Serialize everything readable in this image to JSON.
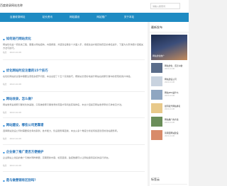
{
  "header": {
    "logo": "百度收录网站名称",
    "search_placeholder": "请输入搜索词"
  },
  "nav": [
    "百度收录网址",
    "站长资讯",
    "网站建设",
    "网站推广",
    "关于本站"
  ],
  "posts": [
    {
      "title": "如何进行网站优化",
      "body": "网站优化是一项系统工程，需要从网站结构、内容质量、外链建设等多个方面入手，持续改进才能获得稳定的排名提升，下面为大家详细介绍相关方法与技巧。",
      "meta": [
        "站长",
        "2022-10-08"
      ]
    },
    {
      "title": "优化网站时应注意的15个技巧",
      "body": "在优化网站的过程中需要注意很多细节问题，本文总结了十五个实用技巧，帮助站长更好地提升网站在搜索引擎中的表现和用户体验。",
      "meta": [
        "站长",
        "2022-10-08"
      ]
    },
    {
      "title": "网站收录，怎么做？",
      "body": "网站收录是搜索引擎优化的基础，只有被搜索引擎收录的页面才有机会获得排名，本文介绍提高网站收录率的几种常见方法。",
      "meta": [
        "站长",
        "2022-10-08"
      ]
    },
    {
      "title": "网站建设，哪些公司更靠谱",
      "body": "选择网站建设公司时需要综合考虑案例、技术能力、售后服务等因素，本文从多个角度分析如何挑选靠谱的建站服务商。",
      "meta": [
        "站长",
        "2022-10-08"
      ]
    },
    {
      "title": "企业做了推广是否方便维护",
      "body": "企业网站上线后的推广与维护同样重要，定期更新内容、检查链接、监控数据可以让网站保持良好的运行状态。",
      "meta": [
        "站长",
        "2022-10-08"
      ]
    },
    {
      "title": "是与做营销有区别吗？",
      "body": "",
      "meta": []
    }
  ],
  "side": {
    "title": "最新发布",
    "banner_caption": "网站优化推广",
    "items": [
      {
        "text": "网站优化，该怎么做",
        "date": "2022-10-08"
      },
      {
        "text": "网站建设公司",
        "date": "2022-10-08"
      },
      {
        "text": "网站SEO是什么",
        "date": "2022-10-08"
      },
      {
        "text": "如何提升网站排名",
        "date": "2022-10-08"
      },
      {
        "text": "网站推广的方法",
        "date": "2022-10-08"
      },
      {
        "text": "营销型网站建设",
        "date": "2022-10-08"
      }
    ],
    "title2": "标签云"
  },
  "colors": {
    "nav": "#1e8bc3",
    "link": "#1e6fb8",
    "thumbs": [
      "#5b6d8a",
      "#c9d3df",
      "#8fa6c1",
      "#e8c98a",
      "#6b8e5a",
      "#d88b6a"
    ]
  }
}
